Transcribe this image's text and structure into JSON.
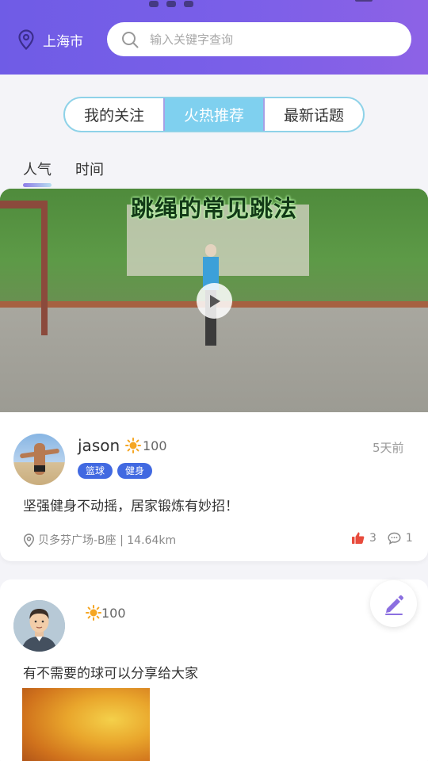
{
  "header": {
    "city": "上海市",
    "search_placeholder": "输入关键字查询"
  },
  "segment": {
    "options": [
      "我的关注",
      "火热推荐",
      "最新话题"
    ],
    "active_index": 1
  },
  "sort_tabs": {
    "options": [
      "人气",
      "时间"
    ],
    "active_index": 0
  },
  "posts": [
    {
      "video_title": "跳绳的常见跳法",
      "username": "jason",
      "sun_score": "100",
      "time": "5天前",
      "tags": [
        "篮球",
        "健身"
      ],
      "content": "坚强健身不动摇，居家锻炼有妙招！",
      "location": "贝多芬广场-B座 | 14.64km",
      "likes": "3",
      "comments": "1"
    },
    {
      "sun_score": "100",
      "content": "有不需要的球可以分享给大家"
    }
  ],
  "colors": {
    "header_gradient_start": "#6f5ce6",
    "header_gradient_end": "#8d62e6",
    "segment_active": "#7fd0ef",
    "tag_bg": "#4169e1",
    "like_red": "#e84b3c",
    "fab_icon": "#8b6fe0"
  },
  "icons": {
    "location": "location-pin-icon",
    "search": "search-icon",
    "play": "play-icon",
    "sun": "sun-icon",
    "like": "thumbs-up-icon",
    "comment": "comment-icon",
    "edit": "pencil-icon"
  }
}
